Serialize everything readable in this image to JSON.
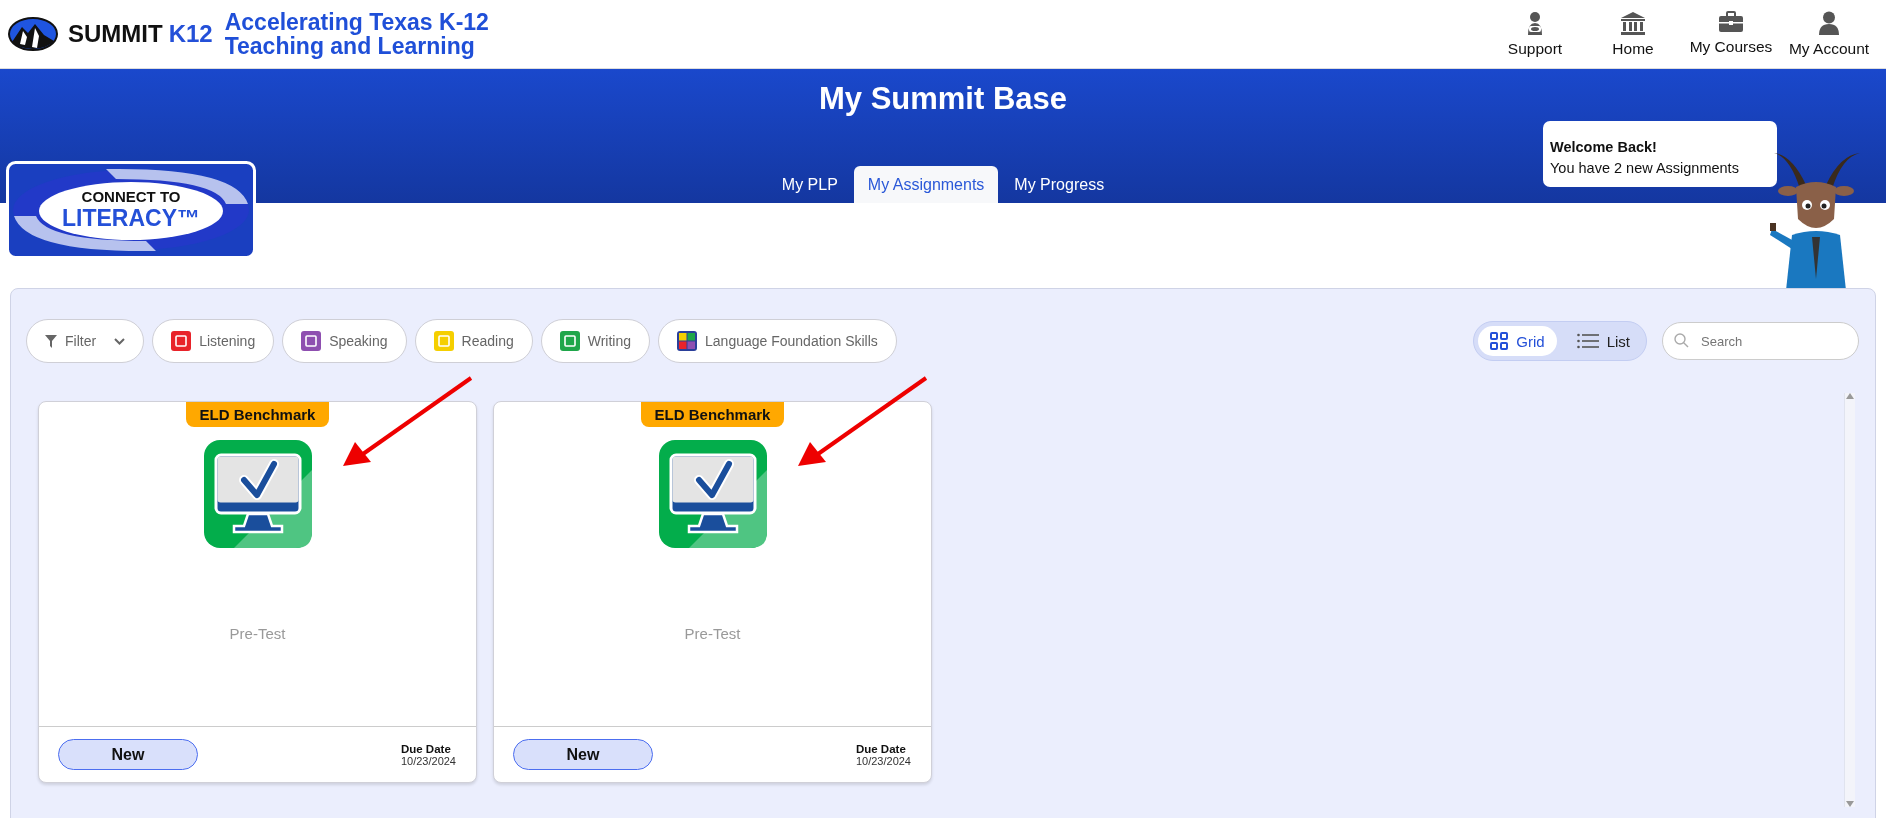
{
  "header": {
    "brand": "SUMMIT",
    "brand_suffix": "K12",
    "tagline": [
      "Accelerating Texas K-12",
      "Teaching and Learning"
    ],
    "nav": [
      {
        "label": "Support"
      },
      {
        "label": "Home"
      },
      {
        "label": "My Courses"
      },
      {
        "label": "My Account"
      }
    ]
  },
  "banner": {
    "title": "My Summit Base",
    "logo_lines": [
      "CONNECT TO",
      "LITERACY™"
    ],
    "tabs": [
      {
        "label": "My PLP",
        "selected": false
      },
      {
        "label": "My Assignments",
        "selected": true
      },
      {
        "label": "My Progress",
        "selected": false
      }
    ],
    "welcome": {
      "heading": "Welcome Back!",
      "message": "You have 2 new Assignments"
    }
  },
  "filters": [
    {
      "kind": "filter",
      "label": "Filter"
    },
    {
      "kind": "skill",
      "label": "Listening",
      "color": "#e8232a"
    },
    {
      "kind": "skill",
      "label": "Speaking",
      "color": "#8e4fb0"
    },
    {
      "kind": "skill",
      "label": "Reading",
      "color": "#f5cf00"
    },
    {
      "kind": "skill",
      "label": "Writing",
      "color": "#1fa64a"
    },
    {
      "kind": "mosaic",
      "label": "Language Foundation Skills"
    }
  ],
  "view_toggle": [
    {
      "label": "Grid",
      "selected": true
    },
    {
      "label": "List",
      "selected": false
    }
  ],
  "search": {
    "placeholder": "Search"
  },
  "cards": [
    {
      "badge": "ELD Benchmark",
      "title": "Pre-Test",
      "status": "New",
      "due_label": "Due Date",
      "due_date": "10/23/2024"
    },
    {
      "badge": "ELD Benchmark",
      "title": "Pre-Test",
      "status": "New",
      "due_label": "Due Date",
      "due_date": "10/23/2024"
    }
  ]
}
